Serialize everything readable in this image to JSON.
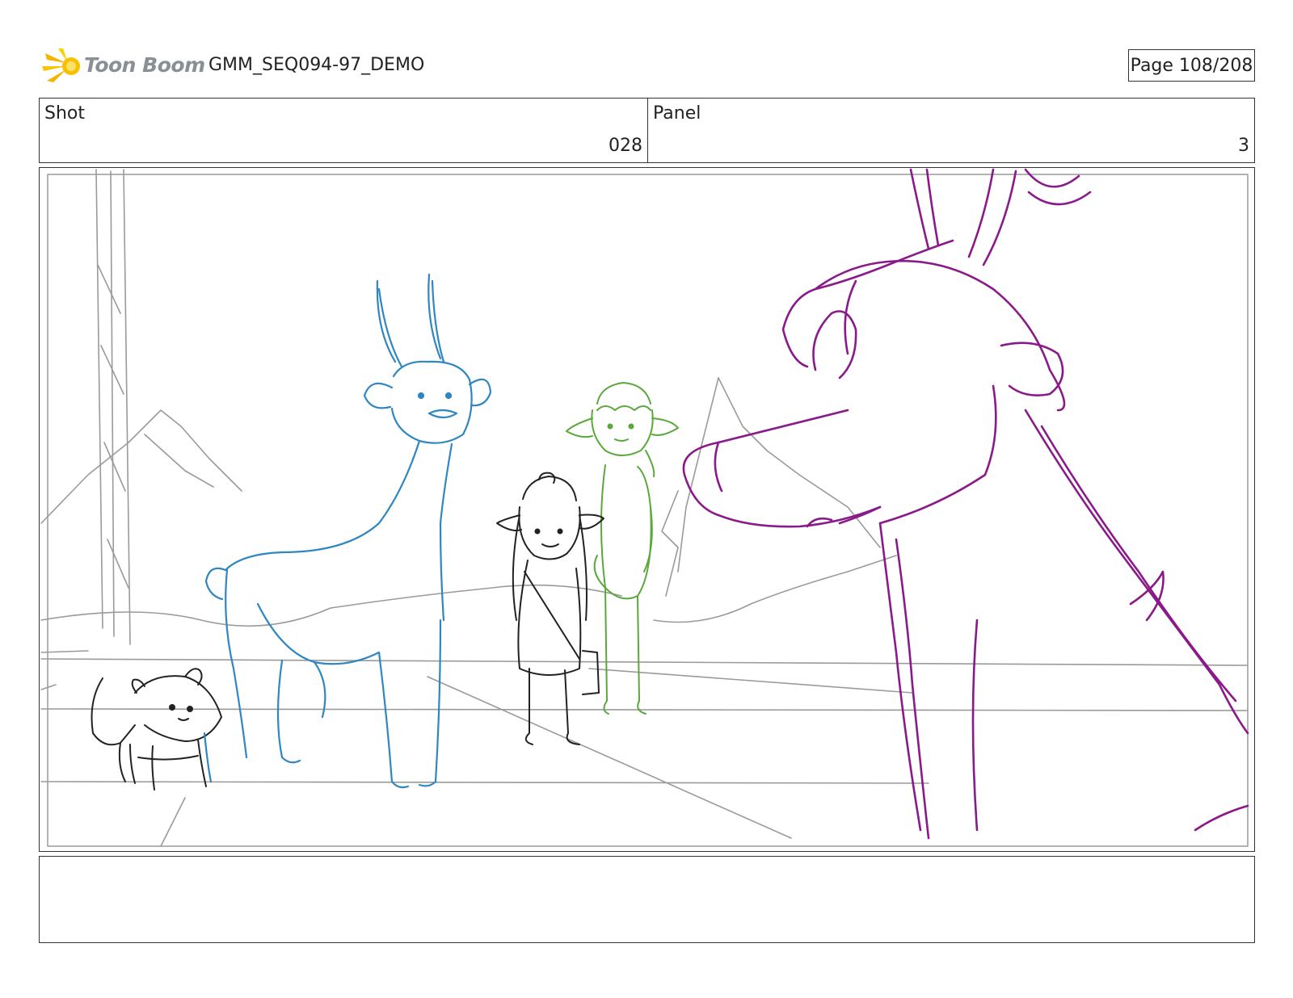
{
  "header": {
    "logo_text": "Toon Boom",
    "logo_icon": "sunburst-logo-icon",
    "document_title": "GMM_SEQ094-97_DEMO",
    "page_label": "Page 108/208"
  },
  "shot_info": {
    "shot_label": "Shot",
    "shot_value": "028",
    "panel_label": "Panel",
    "panel_value": "3"
  },
  "panel": {
    "colors": {
      "background_sketch": "#9a9a9a",
      "foreground_creature": "#222222",
      "deer": "#2f86c1",
      "girl": "#222222",
      "boy": "#5aa83b",
      "giant_deer": "#8a1a8a"
    }
  },
  "notes": {
    "text": ""
  }
}
